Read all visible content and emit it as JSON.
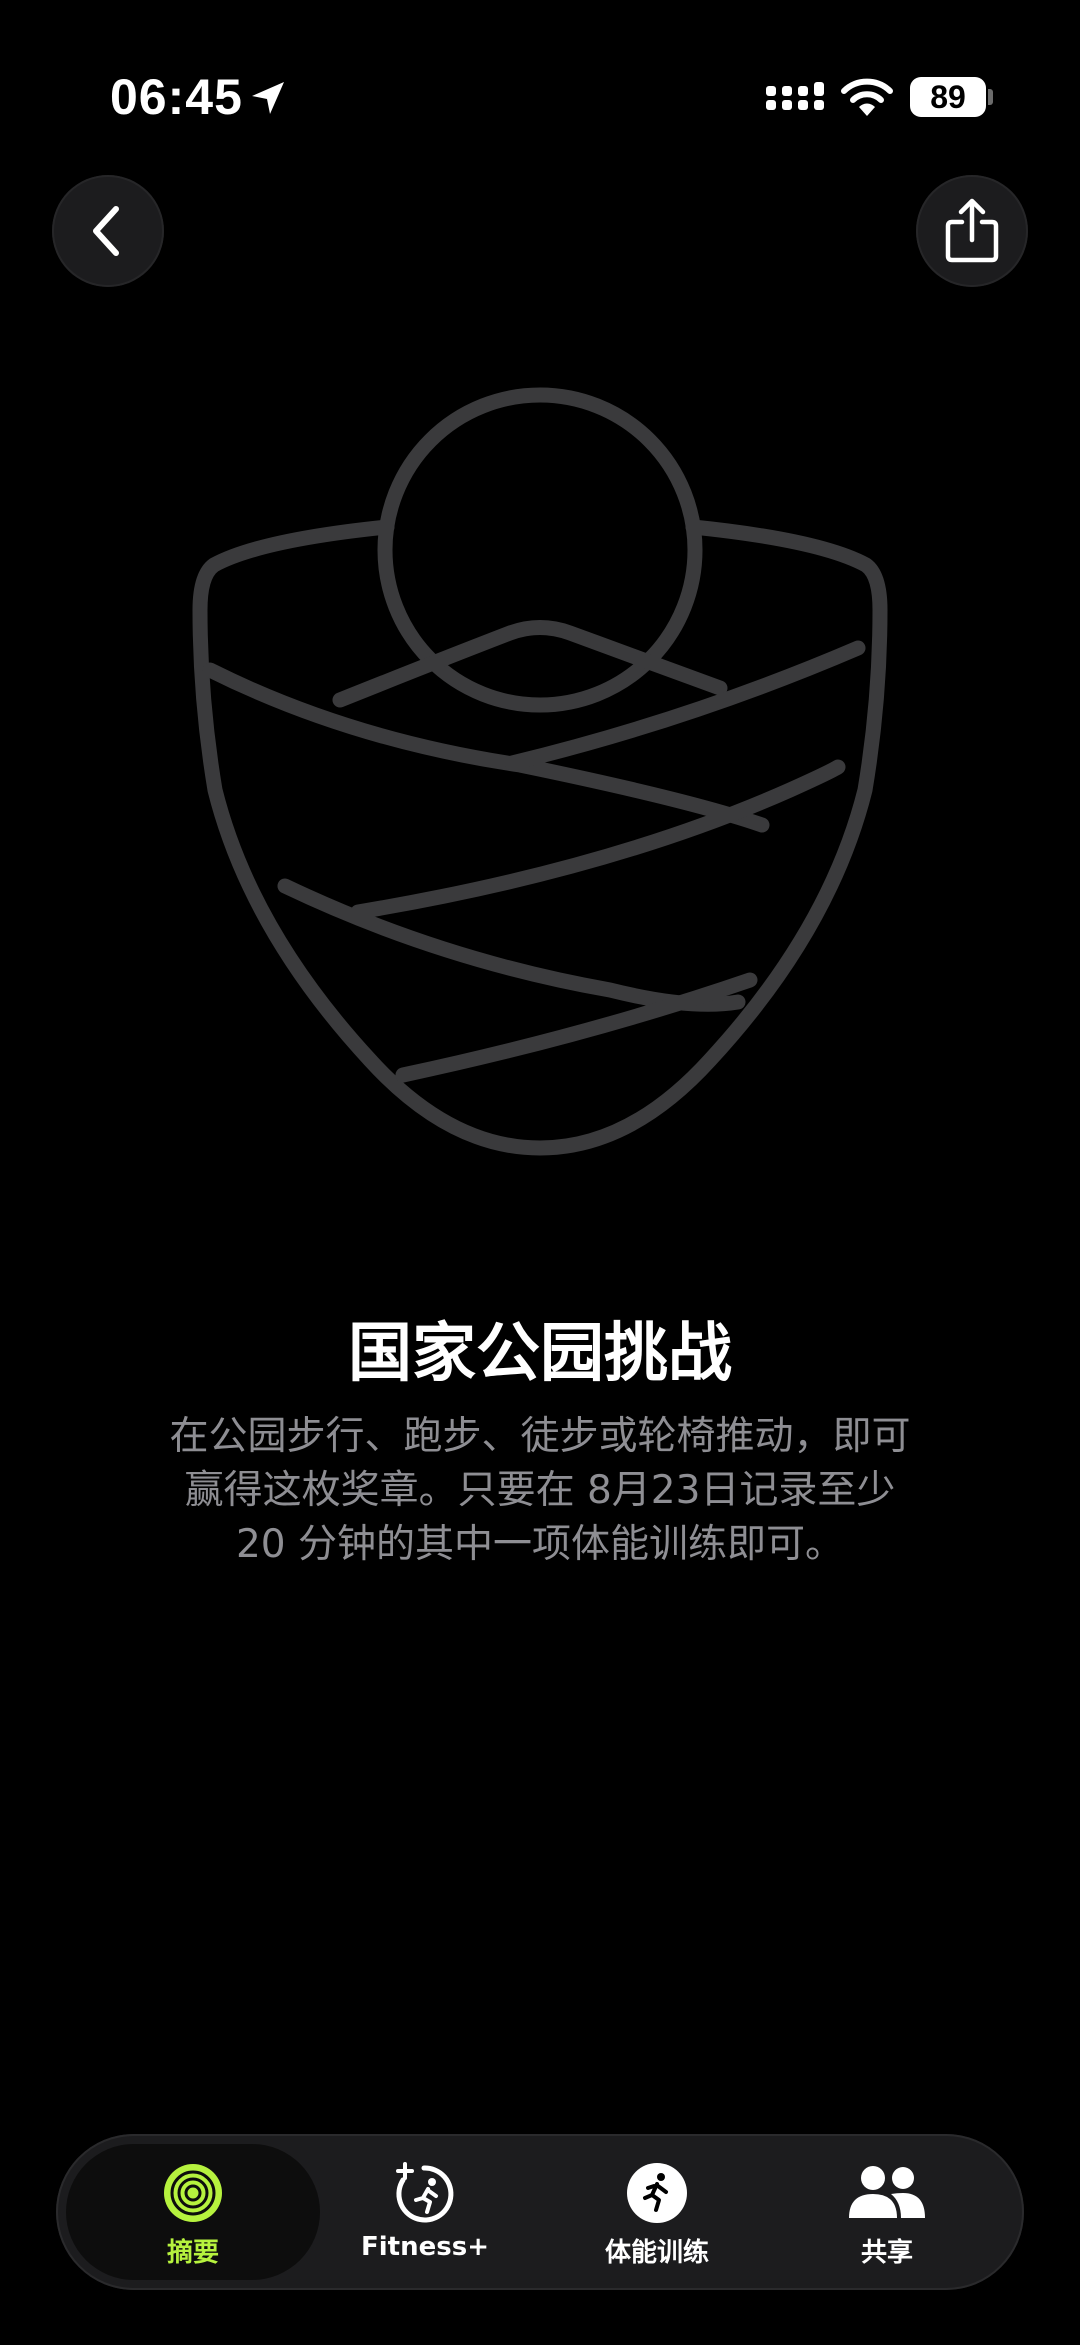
{
  "status_bar": {
    "time": "06:45",
    "battery": "89"
  },
  "icons": {
    "location": "location-arrow-icon",
    "signal": "cellular-signal-icon",
    "wifi": "wifi-icon",
    "back": "chevron-left-icon",
    "share": "share-icon",
    "badge": "national-parks-badge-icon"
  },
  "award": {
    "title": "国家公园挑战",
    "description_line1": "在公园步行、跑步、徒步或轮椅推动，即可",
    "description_line2": "赢得这枚奖章。只要在 8月23日记录至少",
    "description_line3": "20 分钟的其中一项体能训练即可。"
  },
  "tab_bar": {
    "tabs": [
      {
        "label": "摘要",
        "icon": "activity-rings-icon",
        "selected": true
      },
      {
        "label": "Fitness+",
        "icon": "fitness-plus-icon",
        "selected": false
      },
      {
        "label": "体能训练",
        "icon": "running-figure-icon",
        "selected": false
      },
      {
        "label": "共享",
        "icon": "people-icon",
        "selected": false
      }
    ]
  },
  "colors": {
    "accent": "#b6f23e",
    "badge_stroke": "#3a3a3c",
    "secondary_text": "#8e8e93",
    "background": "#000000"
  }
}
